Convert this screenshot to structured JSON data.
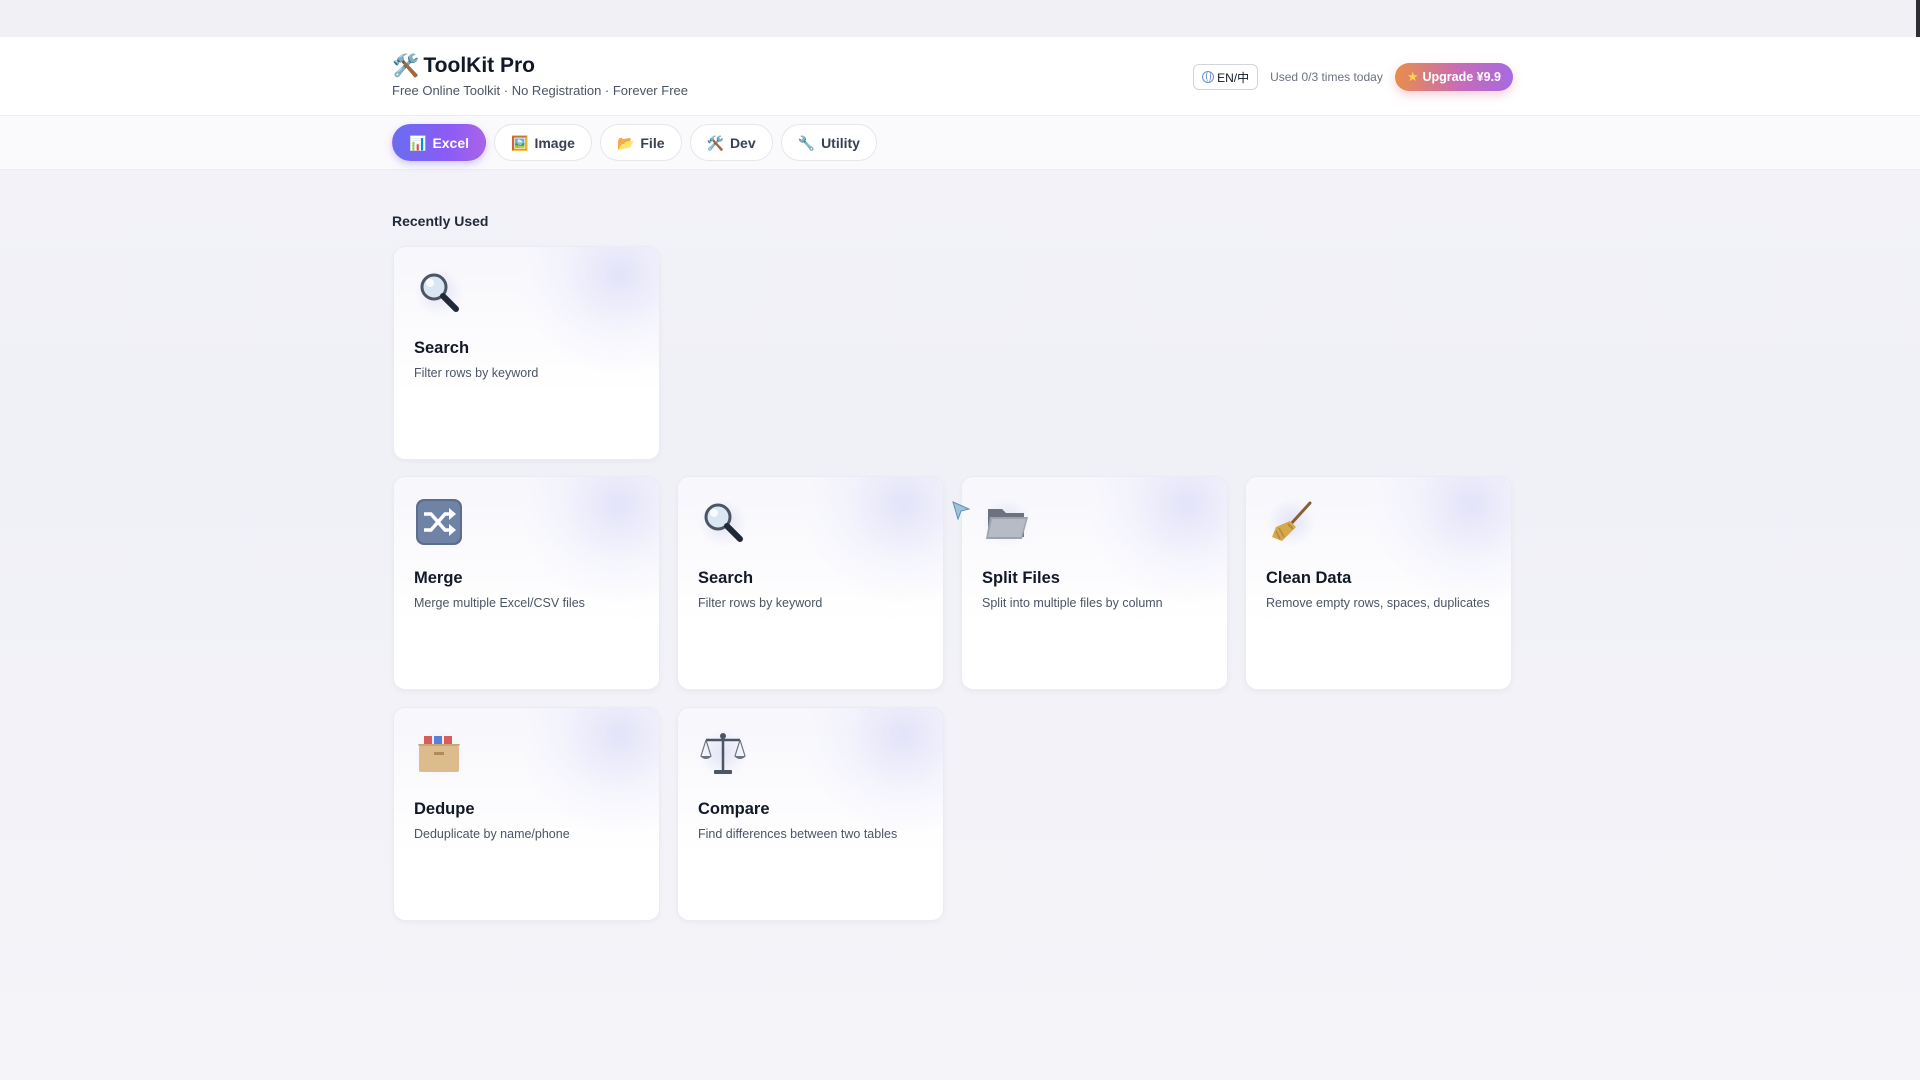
{
  "app": {
    "title": "ToolKit Pro",
    "brand_icon": "hammer-and-wrench-icon",
    "tagline": "Free Online Toolkit · No Registration · Forever Free"
  },
  "header": {
    "lang_label": "EN/中",
    "lang_icon": "globe-icon",
    "usage": "Used 0/3 times today",
    "upgrade_label": "Upgrade ¥9.9",
    "upgrade_icon": "star-icon"
  },
  "tabs": [
    {
      "label": "Excel",
      "icon": "bar-chart-icon",
      "glyph": "📊",
      "active": true
    },
    {
      "label": "Image",
      "icon": "framed-picture-icon",
      "glyph": "🖼️",
      "active": false
    },
    {
      "label": "File",
      "icon": "folder-icon",
      "glyph": "📂",
      "active": false
    },
    {
      "label": "Dev",
      "icon": "hammer-and-wrench-icon",
      "glyph": "🛠️",
      "active": false
    },
    {
      "label": "Utility",
      "icon": "wrench-icon",
      "glyph": "🔧",
      "active": false
    }
  ],
  "recent": {
    "title": "Recently Used",
    "cards": [
      {
        "title": "Search",
        "desc": "Filter rows by keyword",
        "icon": "magnifier-icon",
        "glyph": "🔍"
      }
    ]
  },
  "tools": [
    {
      "title": "Merge",
      "desc": "Merge multiple Excel/CSV files",
      "icon": "shuffle-icon",
      "glyph": "🔀"
    },
    {
      "title": "Search",
      "desc": "Filter rows by keyword",
      "icon": "magnifier-icon",
      "glyph": "🔍"
    },
    {
      "title": "Split Files",
      "desc": "Split into multiple files by column",
      "icon": "open-folder-icon",
      "glyph": "📂"
    },
    {
      "title": "Clean Data",
      "desc": "Remove empty rows, spaces, duplicates",
      "icon": "broom-icon",
      "glyph": "🧹"
    },
    {
      "title": "Dedupe",
      "desc": "Deduplicate by name/phone",
      "icon": "card-file-box-icon",
      "glyph": "🗃️"
    },
    {
      "title": "Compare",
      "desc": "Find differences between two tables",
      "icon": "balance-scale-icon",
      "glyph": "⚖️"
    }
  ],
  "colors": {
    "accent": "#7c5cf0",
    "upgrade_gradient_start": "#e88e4a",
    "upgrade_gradient_end": "#a66ae0"
  }
}
